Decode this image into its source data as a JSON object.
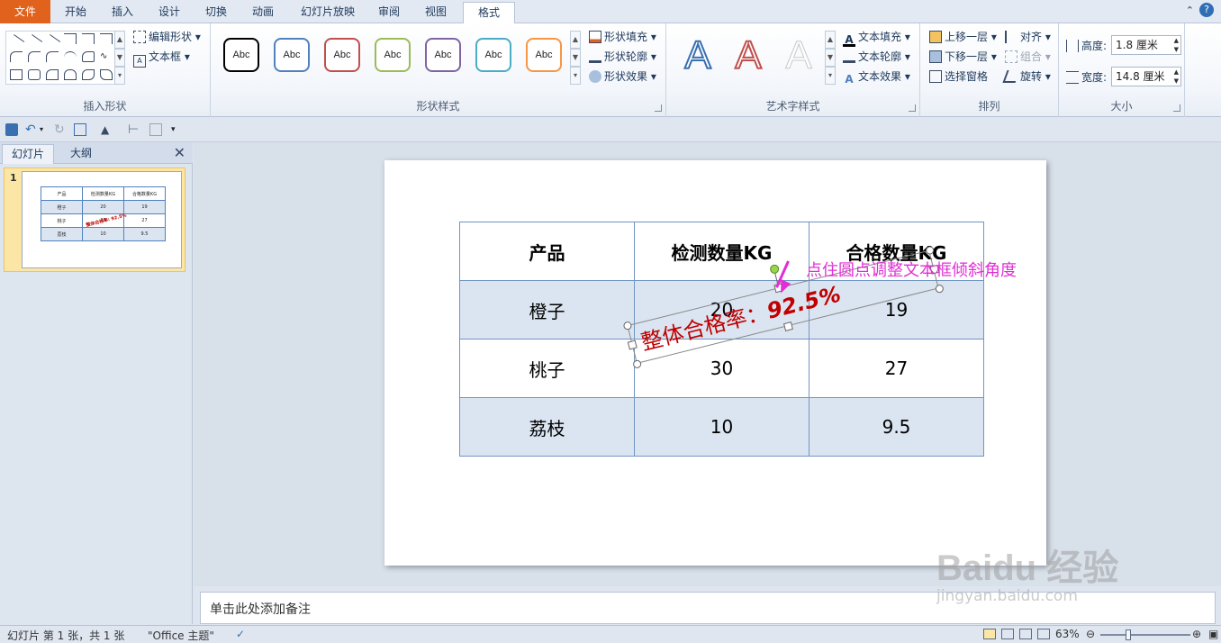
{
  "ribbon_tabs": [
    "文件",
    "开始",
    "插入",
    "设计",
    "切换",
    "动画",
    "幻灯片放映",
    "审阅",
    "视图",
    "格式"
  ],
  "active_tab": "格式",
  "colors": {
    "file_tab": "#e0621c",
    "accent": "#2f6db5",
    "annotation": "#e02fd3",
    "textbox_text": "#c00000",
    "table_border": "#4f81bd",
    "table_band": "#dbe5f1"
  },
  "insert_shapes": {
    "edit_shape": "编辑形状",
    "text_box": "文本框",
    "label": "插入形状"
  },
  "shape_styles": {
    "preset_label": "Abc",
    "fill": "形状填充",
    "outline": "形状轮廓",
    "effects": "形状效果",
    "label": "形状样式",
    "preset_colors": [
      "#000000",
      "#4f81bd",
      "#c0504d",
      "#9bbb59",
      "#8064a2",
      "#4bacc6",
      "#f79646"
    ]
  },
  "wordart_styles": {
    "text_fill": "文本填充",
    "text_outline": "文本轮廓",
    "text_effects": "文本效果",
    "label": "艺术字样式",
    "glyph": "A"
  },
  "arrange": {
    "bring_forward": "上移一层",
    "send_backward": "下移一层",
    "selection_pane": "选择窗格",
    "align": "对齐",
    "group": "组合",
    "rotate": "旋转",
    "label": "排列"
  },
  "size": {
    "height_label": "高度:",
    "height_value": "1.8 厘米",
    "width_label": "宽度:",
    "width_value": "14.8 厘米",
    "label": "大小"
  },
  "panel_tabs": {
    "slides": "幻灯片",
    "outline": "大纲"
  },
  "thumbnail": {
    "number": "1",
    "overlay": "整体合格率: 92.5%"
  },
  "table": {
    "headers": [
      "产品",
      "检测数量KG",
      "合格数量KG"
    ],
    "rows": [
      [
        "橙子",
        "20",
        "19"
      ],
      [
        "桃子",
        "30",
        "27"
      ],
      [
        "荔枝",
        "10",
        "9.5"
      ]
    ]
  },
  "textbox": {
    "label": "整体合格率：",
    "value": "92.5%"
  },
  "annotation": "点住圆点调整文本框倾斜角度",
  "notes_placeholder": "单击此处添加备注",
  "status": {
    "slide_info": "幻灯片 第 1 张，共 1 张",
    "theme": "\"Office 主题\"",
    "zoom": "63%"
  },
  "watermark": {
    "brand": "Baidu 经验",
    "url": "jingyan.baidu.com"
  }
}
